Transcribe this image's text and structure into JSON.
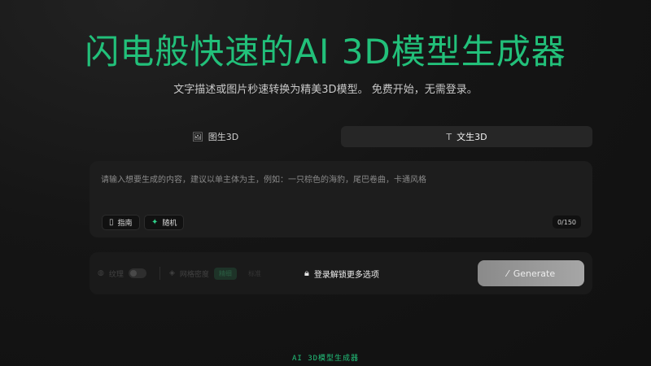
{
  "hero": {
    "title": "闪电般快速的AI 3D模型生成器",
    "subtitle": "文字描述或图片秒速转换为精美3D模型。 免费开始，无需登录。"
  },
  "tabs": [
    {
      "label": "图生3D",
      "icon": "image-icon",
      "active": false
    },
    {
      "label": "文生3D",
      "icon": "text-icon",
      "active": true
    }
  ],
  "prompt": {
    "placeholder": "请输入想要生成的内容，建议以单主体为主，例如：一只棕色的海豹，尾巴卷曲，卡通风格",
    "value": "",
    "counter": "0/150",
    "guide_label": "指南",
    "random_label": "随机"
  },
  "options": {
    "texture_label": "纹理",
    "mesh_label": "网格密度",
    "quality_label": "精细",
    "standard_label": "标准",
    "unlock_label": "登录解锁更多选项"
  },
  "generate": {
    "label": "Generate"
  },
  "footer": {
    "text": "AI 3D模型生成器"
  },
  "colors": {
    "accent": "#22c07a",
    "background": "#151515",
    "panel": "#1d1d1d"
  }
}
